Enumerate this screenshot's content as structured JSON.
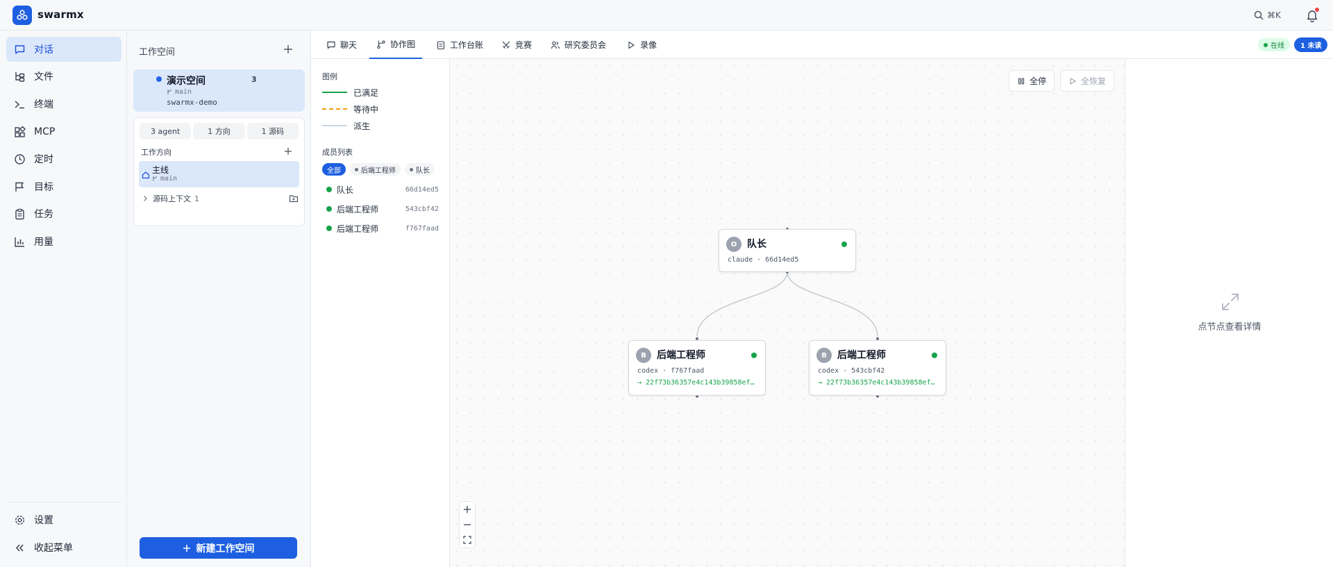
{
  "app": {
    "brand": "swarmx"
  },
  "topbar": {
    "search_shortcut": "⌘K",
    "has_notification": true
  },
  "nav": {
    "items": [
      {
        "label": "对话",
        "icon": "chat-icon",
        "active": true
      },
      {
        "label": "文件",
        "icon": "file-tree-icon",
        "active": false
      },
      {
        "label": "终端",
        "icon": "terminal-icon",
        "active": false
      },
      {
        "label": "MCP",
        "icon": "blocks-icon",
        "active": false
      },
      {
        "label": "定时",
        "icon": "clock-icon",
        "active": false
      },
      {
        "label": "目标",
        "icon": "flag-icon",
        "active": false
      },
      {
        "label": "任务",
        "icon": "clipboard-icon",
        "active": false
      },
      {
        "label": "用量",
        "icon": "bar-chart-icon",
        "active": false
      }
    ],
    "bottom": [
      {
        "label": "设置",
        "icon": "gear-icon"
      },
      {
        "label": "收起菜单",
        "icon": "collapse-icon"
      }
    ]
  },
  "workspace": {
    "title": "工作空间",
    "current": {
      "name": "演示空间",
      "count": "3",
      "branch": "main",
      "repo": "swarmx-demo"
    },
    "stats": [
      "3 agent",
      "1 方向",
      "1 源码"
    ],
    "directions_title": "工作方向",
    "directions": [
      {
        "name": "主线",
        "branch": "main"
      }
    ],
    "source_context": {
      "label": "源码上下文",
      "count": "1"
    },
    "new_button": "新建工作空间"
  },
  "tabs": [
    {
      "label": "聊天",
      "icon": "chat-icon",
      "active": false
    },
    {
      "label": "协作图",
      "icon": "git-branch-icon",
      "active": true
    },
    {
      "label": "工作台账",
      "icon": "ledger-icon",
      "active": false
    },
    {
      "label": "竞赛",
      "icon": "swords-icon",
      "active": false
    },
    {
      "label": "研究委员会",
      "icon": "users-icon",
      "active": false
    },
    {
      "label": "录像",
      "icon": "play-icon",
      "active": false
    }
  ],
  "status": {
    "online": "在线",
    "unread": "1 未读"
  },
  "legend": {
    "title": "图例",
    "items": [
      {
        "label": "已满足",
        "color": "#16a34a",
        "style": "solid"
      },
      {
        "label": "等待中",
        "color": "#f59e0b",
        "style": "dashed"
      },
      {
        "label": "派生",
        "color": "#cbd5e1",
        "style": "solid"
      }
    ]
  },
  "members": {
    "title": "成员列表",
    "filters": [
      "全部",
      "后端工程师",
      "队长"
    ],
    "list": [
      {
        "name": "队长",
        "id": "66d14ed5"
      },
      {
        "name": "后端工程师",
        "id": "543cbf42"
      },
      {
        "name": "后端工程师",
        "id": "f767faad"
      }
    ]
  },
  "canvas": {
    "stop_all": "全停",
    "resume_all": "全恢复",
    "nodes": [
      {
        "avatar": "O",
        "name": "队长",
        "meta": "claude · 66d14ed5",
        "commit": ""
      },
      {
        "avatar": "B",
        "name": "后端工程师",
        "meta": "codex · f767faad",
        "commit": "→ 22f73b36357e4c143b39858ef…"
      },
      {
        "avatar": "B",
        "name": "后端工程师",
        "meta": "codex · 543cbf42",
        "commit": "→ 22f73b36357e4c143b39858ef…"
      }
    ]
  },
  "detail": {
    "hint": "点节点查看详情"
  },
  "colors": {
    "accent": "#1d5fe0",
    "active_bg": "#dbe8fb",
    "online": "#16a34a"
  }
}
